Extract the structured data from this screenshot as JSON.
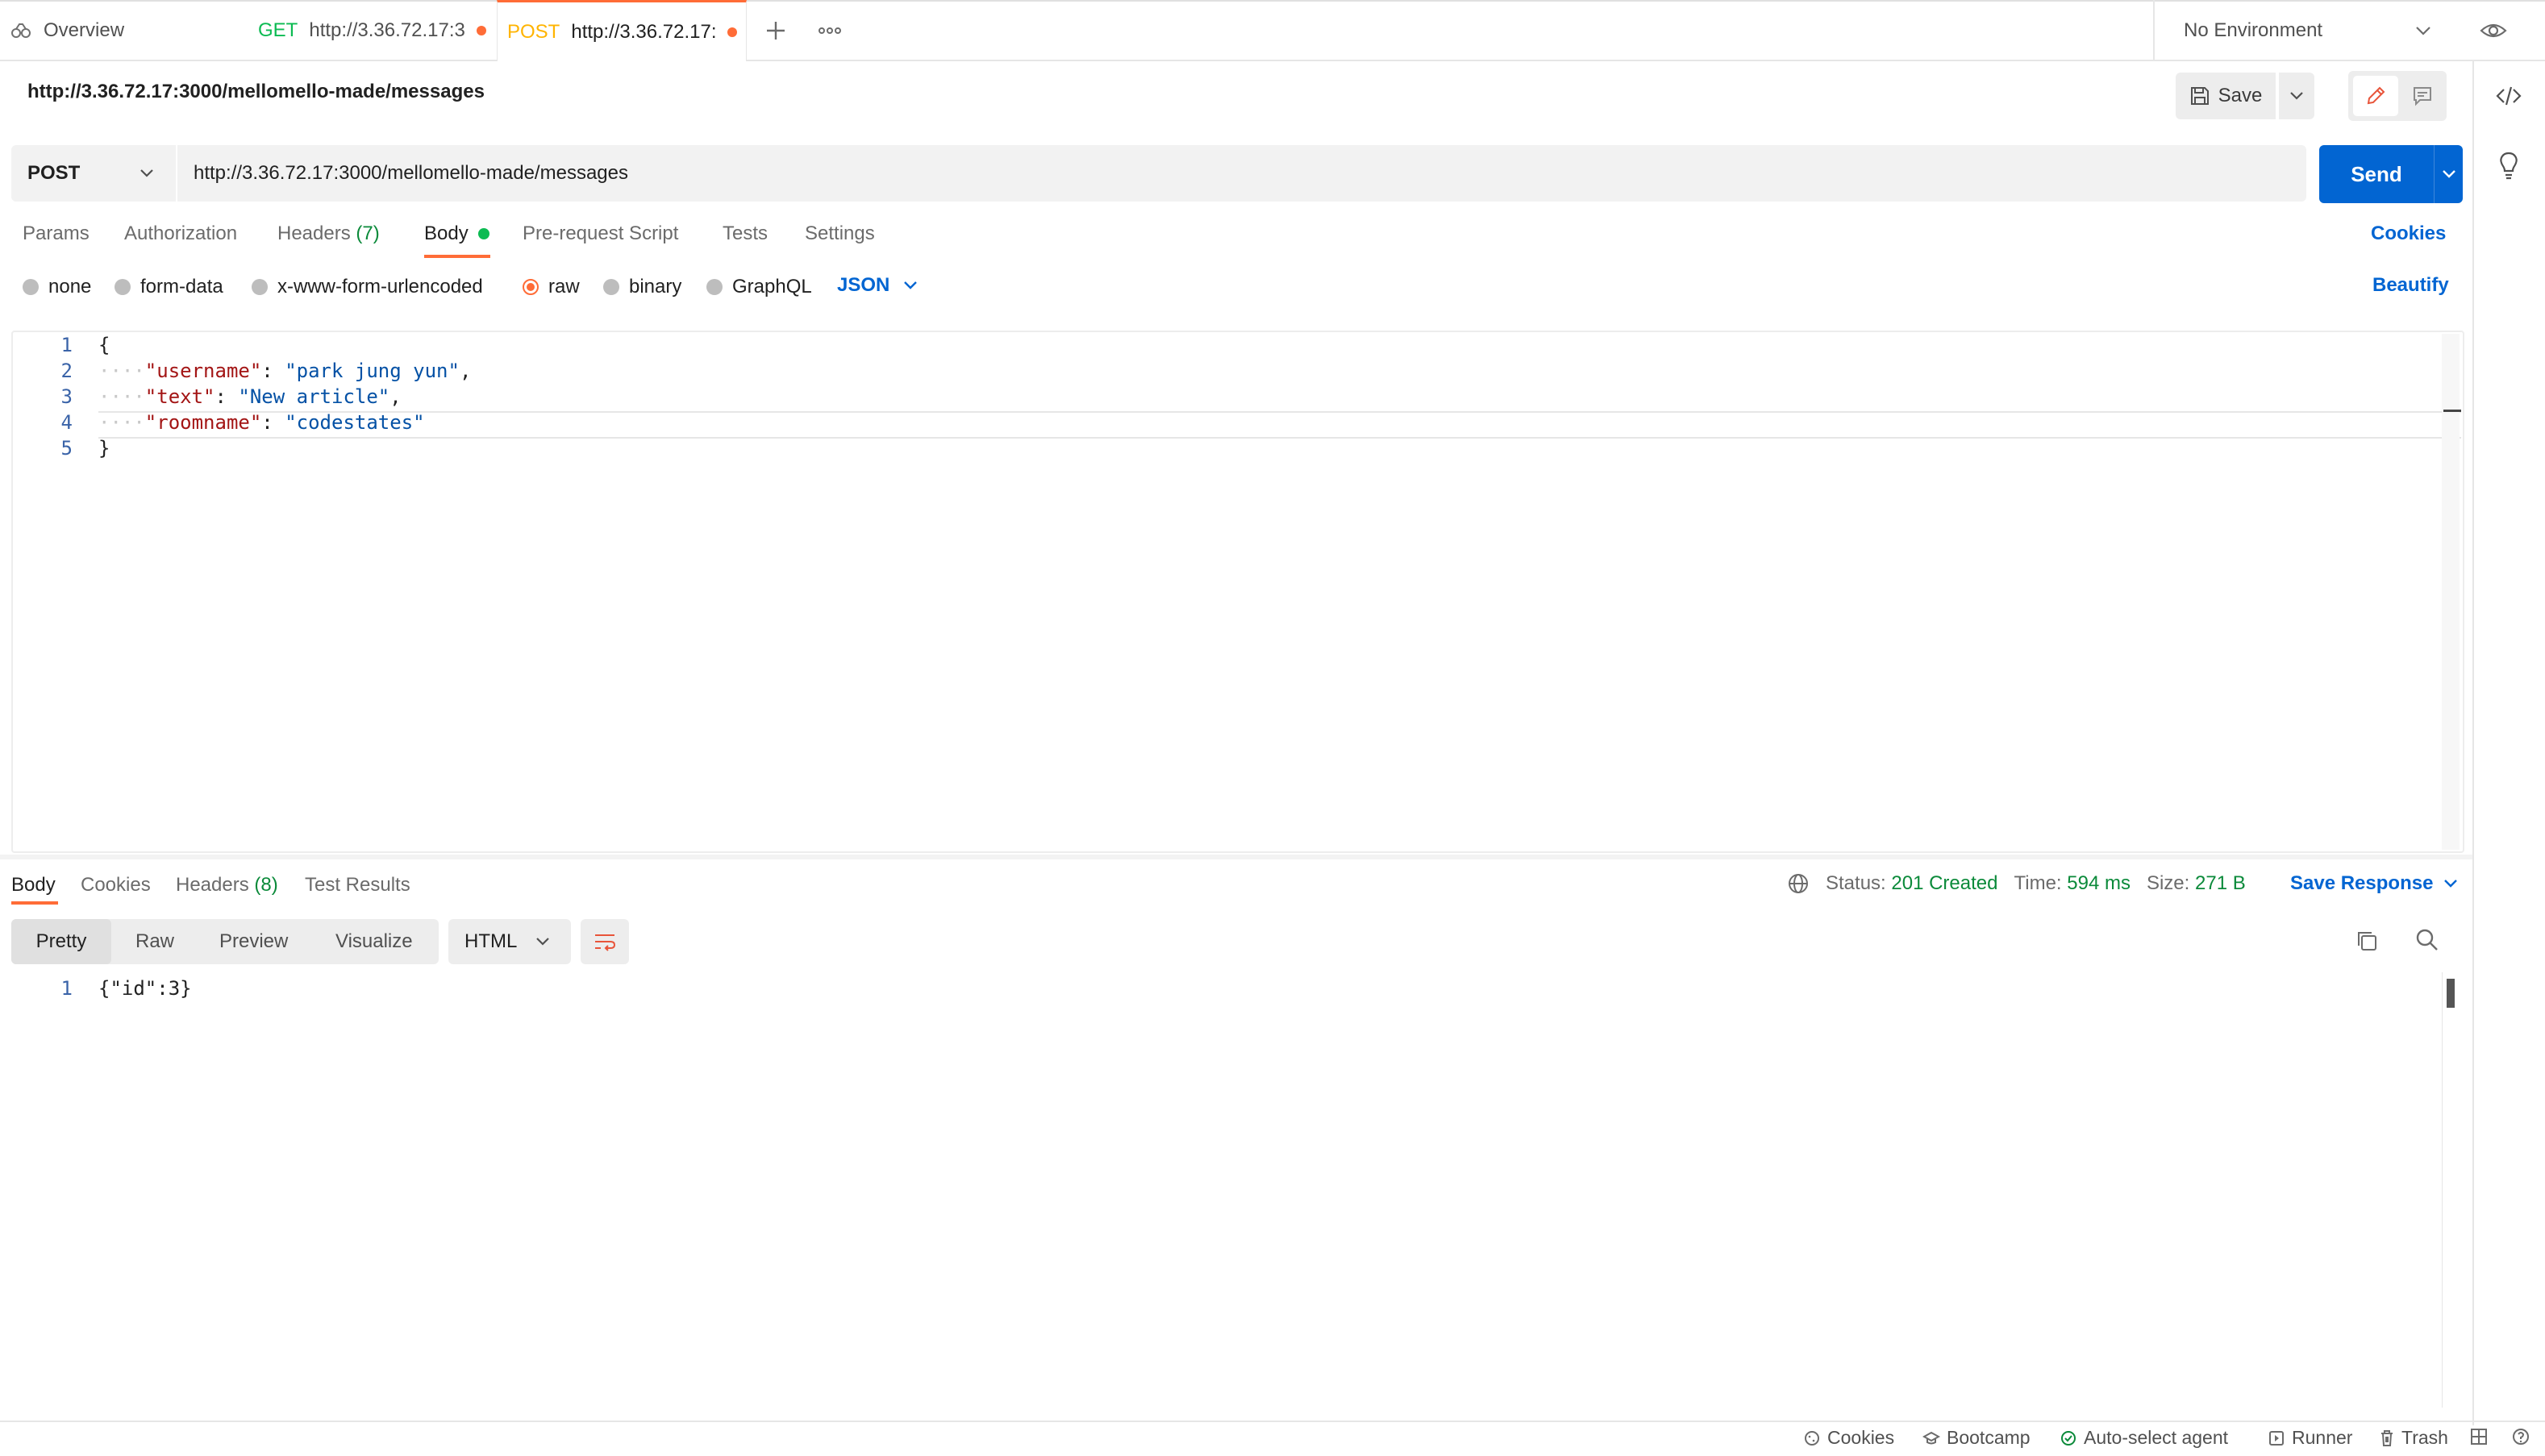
{
  "tabs": {
    "overview_label": "Overview",
    "tab1_method": "GET",
    "tab1_url": "http://3.36.72.17:3",
    "tab2_method": "POST",
    "tab2_url": "http://3.36.72.17:"
  },
  "environment": {
    "label": "No Environment"
  },
  "request": {
    "title": "http://3.36.72.17:3000/mellomello-made/messages",
    "save_label": "Save",
    "method": "POST",
    "url": "http://3.36.72.17:3000/mellomello-made/messages",
    "send_label": "Send"
  },
  "request_tabs": {
    "params": "Params",
    "authorization": "Authorization",
    "headers": "Headers",
    "headers_count": "(7)",
    "body": "Body",
    "prerequest": "Pre-request Script",
    "tests": "Tests",
    "settings": "Settings",
    "cookies": "Cookies"
  },
  "body_types": {
    "none": "none",
    "form_data": "form-data",
    "urlencoded": "x-www-form-urlencoded",
    "raw": "raw",
    "binary": "binary",
    "graphql": "GraphQL",
    "language": "JSON",
    "beautify": "Beautify"
  },
  "editor": {
    "line_numbers": [
      "1",
      "2",
      "3",
      "4",
      "5"
    ],
    "open_brace": "{",
    "close_brace": "}",
    "username_key": "\"username\"",
    "username_value": "\"park jung yun\"",
    "text_key": "\"text\"",
    "text_value": "\"New article\"",
    "roomname_key": "\"roomname\"",
    "roomname_value": "\"codestates\""
  },
  "response": {
    "tabs": {
      "body": "Body",
      "cookies": "Cookies",
      "headers": "Headers",
      "headers_count": "(8)",
      "test_results": "Test Results"
    },
    "status_label": "Status:",
    "status_value": "201 Created",
    "time_label": "Time:",
    "time_value": "594 ms",
    "size_label": "Size:",
    "size_value": "271 B",
    "save_response": "Save Response",
    "view_modes": {
      "pretty": "Pretty",
      "raw": "Raw",
      "preview": "Preview",
      "visualize": "Visualize"
    },
    "format": "HTML",
    "line_number": "1",
    "body_text": "{\"id\":3}"
  },
  "statusbar": {
    "cookies": "Cookies",
    "bootcamp": "Bootcamp",
    "agent": "Auto-select agent",
    "runner": "Runner",
    "trash": "Trash"
  },
  "colors": {
    "accent_orange": "#ff6c37",
    "primary_blue": "#0265d2",
    "success_green": "#0b8a3a"
  }
}
